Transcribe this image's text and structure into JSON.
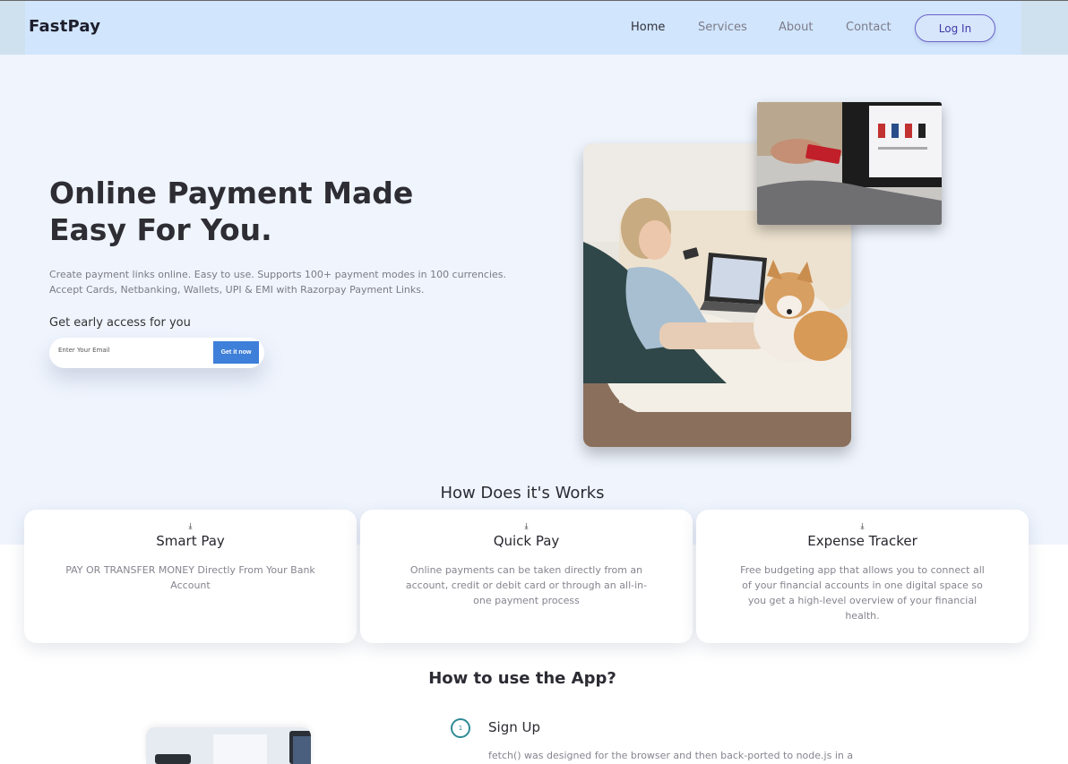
{
  "header": {
    "logo": "FastPay",
    "nav": [
      "Home",
      "Services",
      "About",
      "Contact"
    ],
    "login_label": "Log In"
  },
  "hero": {
    "title_line1": "Online Payment Made",
    "title_line2": "Easy For You.",
    "desc_line1": "Create payment links online. Easy to use. Supports 100+ payment modes in 100 currencies.",
    "desc_line2": "Accept Cards, Netbanking, Wallets, UPI & EMI with Razorpay Payment Links.",
    "early_access": "Get early access for you",
    "email_placeholder": "Enter Your Email",
    "cta_label": "Get it now"
  },
  "how": {
    "title": "How Does it's Works",
    "icon": "download-icon",
    "cards": [
      {
        "title": "Smart Pay",
        "text": "PAY OR TRANSFER MONEY Directly From Your Bank Account"
      },
      {
        "title": "Quick Pay",
        "text": "Online payments can be taken directly from an account, credit or debit card or through an all-in-one payment process"
      },
      {
        "title": "Expense Tracker",
        "text": "Free budgeting app that allows you to connect all of your financial accounts in one digital space so you get a high-level overview of your financial health."
      }
    ]
  },
  "use": {
    "title": "How to use the App?",
    "step_number": "1",
    "step_title": "Sign Up",
    "step_text": "fetch() was designed for the browser and then back-ported to node.js in a"
  },
  "colors": {
    "header_bg": "#d1e5fc",
    "hero_bg": "#eff4fd",
    "accent": "#3d7fd9",
    "login_border": "#6b63c9",
    "step_accent": "#2f8a95"
  }
}
